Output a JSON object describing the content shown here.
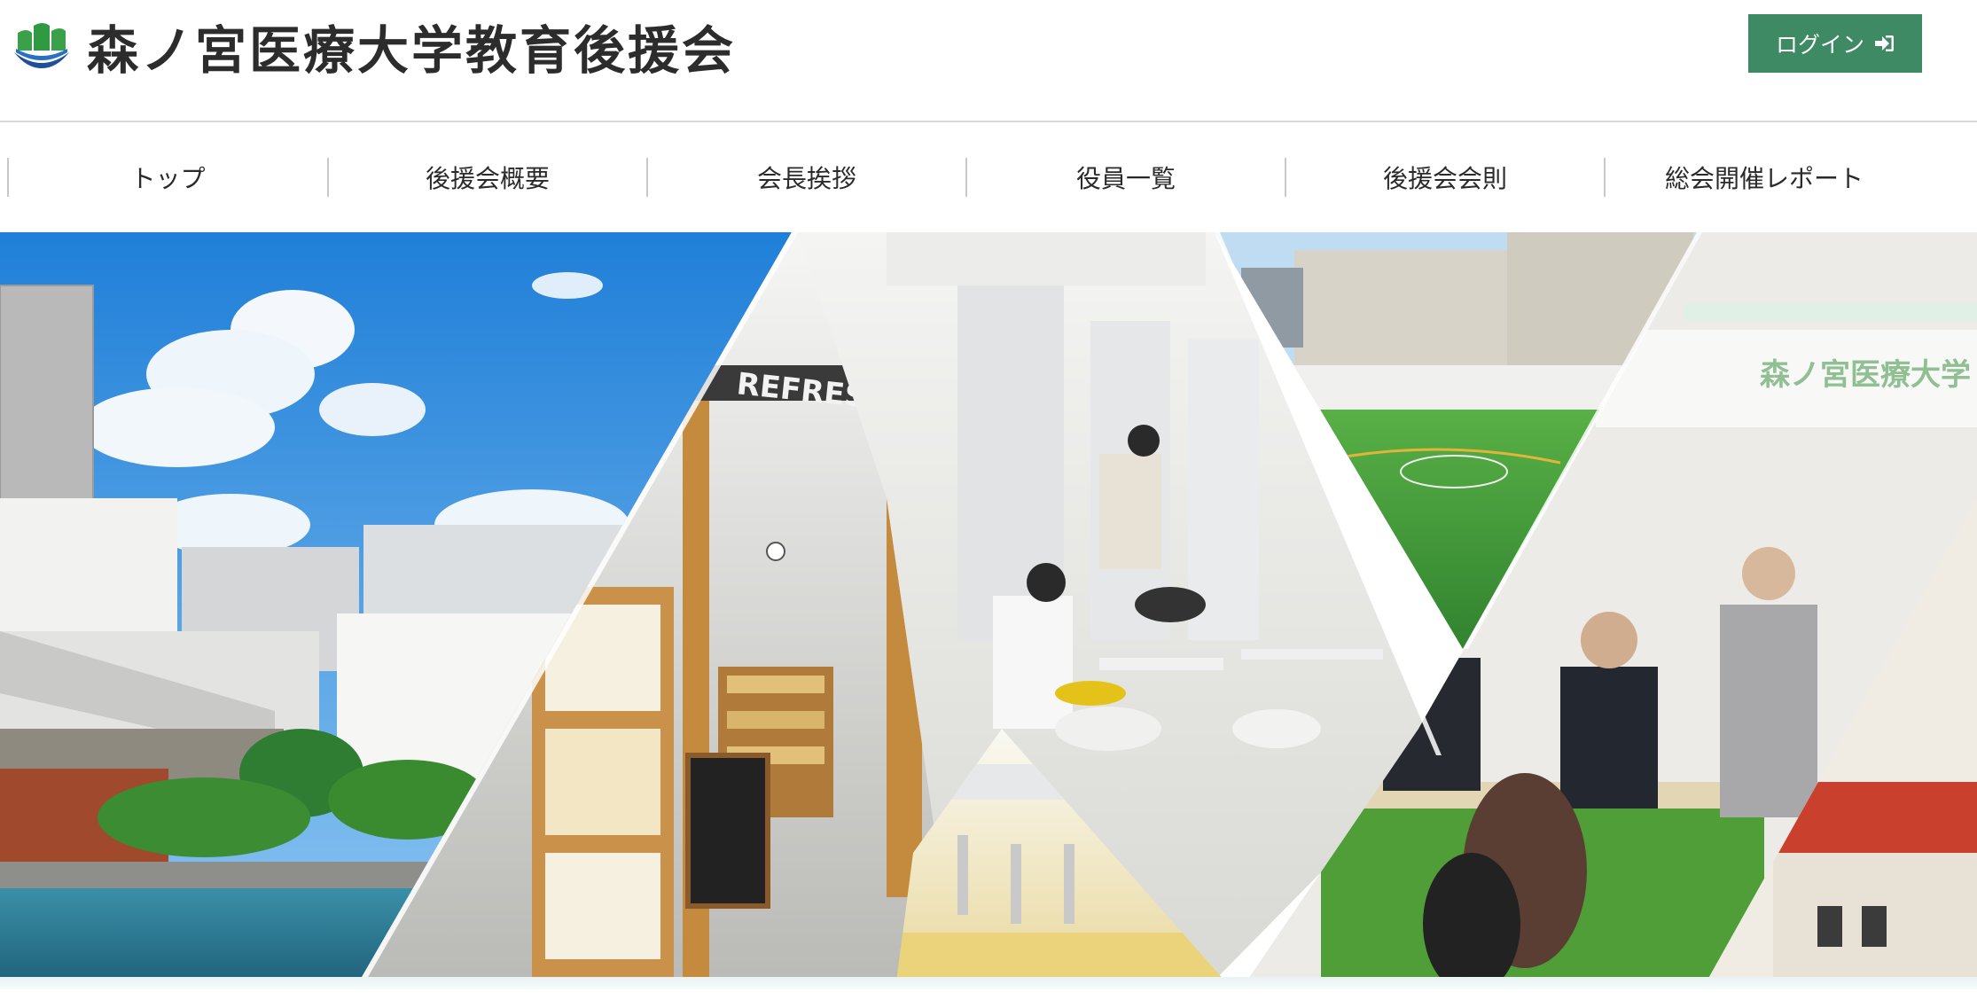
{
  "header": {
    "site_name": "森ノ宮医療大学教育後援会",
    "login_label": "ログイン"
  },
  "nav": {
    "items": [
      {
        "label": "トップ"
      },
      {
        "label": "後援会概要"
      },
      {
        "label": "会長挨拶"
      },
      {
        "label": "役員一覧"
      },
      {
        "label": "後援会会則"
      },
      {
        "label": "総会開催レポート"
      }
    ]
  },
  "hero": {
    "signage_text": "REFRESH ZONE",
    "banner_text": "森ノ宮医療大学"
  },
  "colors": {
    "accent": "#3d8a64",
    "sky": "#2f8fe0",
    "grass": "#3f9a3a",
    "wood": "#c48a3e"
  }
}
